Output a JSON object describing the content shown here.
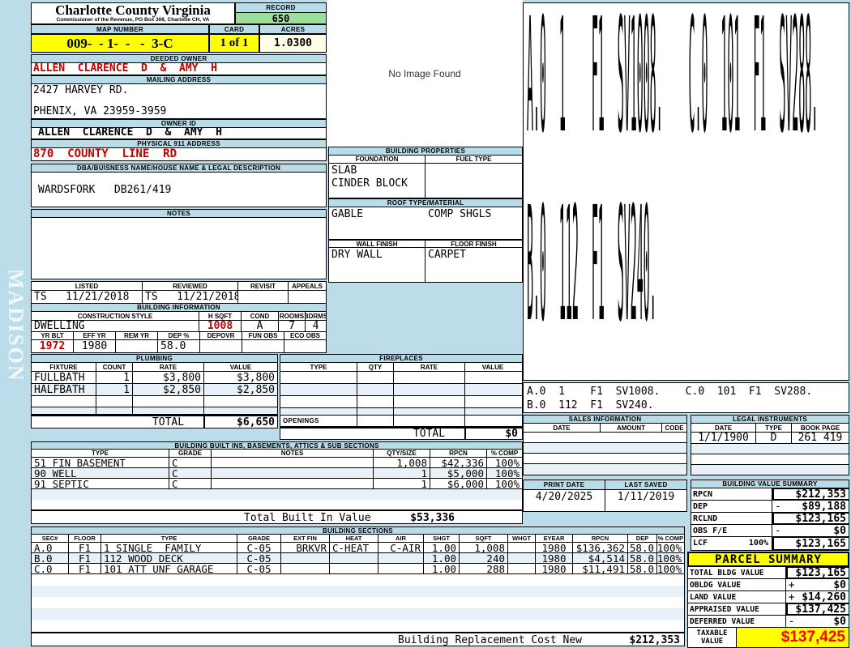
{
  "sidebar": {
    "vertical_text": "MADISON"
  },
  "header": {
    "county_title": "Charlotte County Virginia",
    "county_subtitle": "Commissioner of the Revenue, PO Box 308, Charlotte CH, VA",
    "record_label": "RECORD",
    "record_value": "650",
    "map_label": "MAP NUMBER",
    "map_value": "009-  - 1-  -   -  3-C",
    "card_label": "CARD",
    "card_value": "1 of 1",
    "acres_label": "ACRES",
    "acres_value": "1.0300"
  },
  "owner": {
    "deeded_label": "DEEDED OWNER",
    "deeded_value": "ALLEN  CLARENCE  D  &  AMY  H",
    "mailing_label": "MAILING ADDRESS",
    "mailing_line1": "2427 HARVEY RD.",
    "mailing_line2": "PHENIX, VA 23959-3959",
    "owner_id_label": "OWNER ID",
    "owner_id_value": "ALLEN  CLARENCE  D  &  AMY  H",
    "physical_label": "PHYSICAL 911 ADDRESS",
    "physical_value": "870  COUNTY  LINE  RD",
    "dba_label": "DBA/BUISNESS NAME/HOUSE NAME & LEGAL DESCRIPTION",
    "dba_value": "WARDSFORK   DB261/419",
    "notes_label": "NOTES",
    "notes_value": ""
  },
  "review": {
    "listed_label": "LISTED",
    "reviewed_label": "REVIEWED",
    "revisit_label": "REVISIT",
    "appeals_label": "APPEALS",
    "listed_value": "TS   11/21/2018",
    "reviewed_value": "TS   11/21/2018",
    "revisit_value": "",
    "appeals_value": ""
  },
  "building_info": {
    "title": "BUILDING INFORMATION",
    "style_label": "CONSTRUCTION STYLE",
    "style_value": "DWELLING",
    "hsqft_label": "H SQFT",
    "hsqft_value": "1008",
    "cond_label": "COND",
    "cond_value": "A",
    "rooms_label": "ROOMS",
    "rooms_value": "7",
    "bdrms_label": "BDRMS",
    "bdrms_value": "4",
    "yrblt_label": "YR BLT",
    "yrblt_value": "1972",
    "effyr_label": "EFF YR",
    "effyr_value": "1980",
    "remyr_label": "REM YR",
    "remyr_value": "",
    "dep_label": "DEP %",
    "dep_value": "58.0",
    "depovr_label": "DEPOVR",
    "depovr_value": "",
    "funobs_label": "FUN OBS",
    "funobs_value": "",
    "ecoobs_label": "ECO OBS",
    "ecoobs_value": ""
  },
  "plumbing": {
    "title": "PLUMBING",
    "headers": [
      "FIXTURE",
      "COUNT",
      "RATE",
      "VALUE"
    ],
    "rows": [
      [
        "FULLBATH",
        "1",
        "$3,800",
        "$3,800"
      ],
      [
        "HALFBATH",
        "1",
        "$2,850",
        "$2,850"
      ]
    ],
    "total_label": "TOTAL",
    "total_value": "$6,650"
  },
  "fireplaces": {
    "title": "FIREPLACES",
    "headers": [
      "TYPE",
      "QTY",
      "RATE",
      "VALUE"
    ],
    "openings_label": "OPENINGS",
    "total_label": "TOTAL",
    "total_value": "$0"
  },
  "built_ins": {
    "title": "BUILDING BUILT INS, BASEMENTS, ATTICS & SUB SECTIONS",
    "headers": [
      "TYPE",
      "GRADE",
      "NOTES",
      "QTY/SIZE",
      "RPCN",
      "% COMP"
    ],
    "rows": [
      [
        "51 FIN BASEMENT",
        "C",
        "",
        "1,008",
        "$42,336",
        "100%"
      ],
      [
        "90 WELL",
        "C",
        "",
        "1",
        "$5,000",
        "100%"
      ],
      [
        "91 SEPTIC",
        "C",
        "",
        "1",
        "$6,000",
        "100%"
      ]
    ],
    "total_label": "Total Built In Value",
    "total_value": "$53,336"
  },
  "building_sections": {
    "title": "BUILDING SECTIONS",
    "headers": [
      "SEC#",
      "FLOOR",
      "TYPE",
      "GRADE",
      "EXT FIN",
      "HEAT",
      "AIR",
      "SHGT",
      "SQFT",
      "WHGT",
      "EYEAR",
      "RPCN",
      "DEP",
      "% COMP"
    ],
    "rows": [
      [
        "A.0",
        "F1",
        "1 SINGLE  FAMILY",
        "C-05",
        "BRKVR",
        "C-HEAT",
        "C-AIR",
        "1.00",
        "1,008",
        "",
        "1980",
        "$136,362",
        "58.0",
        "100%"
      ],
      [
        "B.0",
        "F1",
        "112 WOOD DECK",
        "C-05",
        "",
        "",
        "",
        "1.00",
        "240",
        "",
        "1980",
        "$4,514",
        "58.0",
        "100%"
      ],
      [
        "C.0",
        "F1",
        "101 ATT UNF GARAGE",
        "C-05",
        "",
        "",
        "",
        "1.00",
        "288",
        "",
        "1980",
        "$11,491",
        "58.0",
        "100%"
      ]
    ],
    "total_label": "Building Replacement Cost New",
    "total_value": "$212,353"
  },
  "image_panel": {
    "no_image_text": "No Image Found"
  },
  "building_properties": {
    "title": "BUILDING PROPERTIES",
    "foundation_label": "FOUNDATION",
    "fuel_label": "FUEL TYPE",
    "foundation_line1": "SLAB",
    "foundation_line2": "CINDER BLOCK",
    "fuel_value": "",
    "roof_label": "ROOF TYPE/MATERIAL",
    "roof_type": "GABLE",
    "roof_material": "COMP SHGLS",
    "wall_label": "WALL FINISH",
    "floor_label": "FLOOR FINISH",
    "wall_value": "DRY WALL",
    "floor_value": "CARPET"
  },
  "sketch": {
    "line1": "A.0  1    F1  SV1008.    C.0  101  F1  SV288.",
    "line2": "B.0  112  F1  SV240."
  },
  "sales": {
    "title": "SALES INFORMATION",
    "headers": [
      "DATE",
      "AMOUNT",
      "CODE"
    ]
  },
  "legal": {
    "title": "LEGAL INSTRUMENTS",
    "headers": [
      "DATE",
      "TYPE",
      "BOOK PAGE"
    ],
    "rows": [
      [
        "1/1/1900",
        "D",
        "261 419"
      ]
    ]
  },
  "print_info": {
    "print_label": "PRINT DATE",
    "print_value": "4/20/2025",
    "saved_label": "LAST SAVED",
    "saved_value": "1/11/2019"
  },
  "value_summary": {
    "title": "BUILDING VALUE SUMMARY",
    "rows": [
      {
        "label": "RPCN",
        "pct": "",
        "op": "",
        "value": "$212,353"
      },
      {
        "label": "DEP",
        "pct": "",
        "op": "-",
        "value": "$89,188"
      },
      {
        "label": "RCLND",
        "pct": "",
        "op": "",
        "value": "$123,165"
      },
      {
        "label": "OBS F/E",
        "pct": "",
        "op": "-",
        "value": "$0"
      },
      {
        "label": "LCF",
        "pct": "100%",
        "op": "",
        "value": "$123,165"
      }
    ]
  },
  "parcel_summary": {
    "title": "PARCEL SUMMARY",
    "rows": [
      {
        "label": "TOTAL BLDG VALUE",
        "op": "",
        "value": "$123,165"
      },
      {
        "label": "OBLDG VALUE",
        "op": "+",
        "value": "$0"
      },
      {
        "label": "LAND VALUE",
        "op": "+",
        "value": "$14,260"
      },
      {
        "label": "APPRAISED VALUE",
        "op": "",
        "value": "$137,425"
      },
      {
        "label": "DEFERRED VALUE",
        "op": "-",
        "value": "$0"
      }
    ],
    "taxable_label1": "TAXABLE",
    "taxable_label2": "VALUE",
    "taxable_value": "$137,425"
  },
  "colors": {
    "accent_yellow": "#FFFF00",
    "record_green": "#9BDF9B",
    "alert_red": "#C00000",
    "taxable_red": "#FF0000",
    "panel_blue": "#B9DCE9"
  }
}
